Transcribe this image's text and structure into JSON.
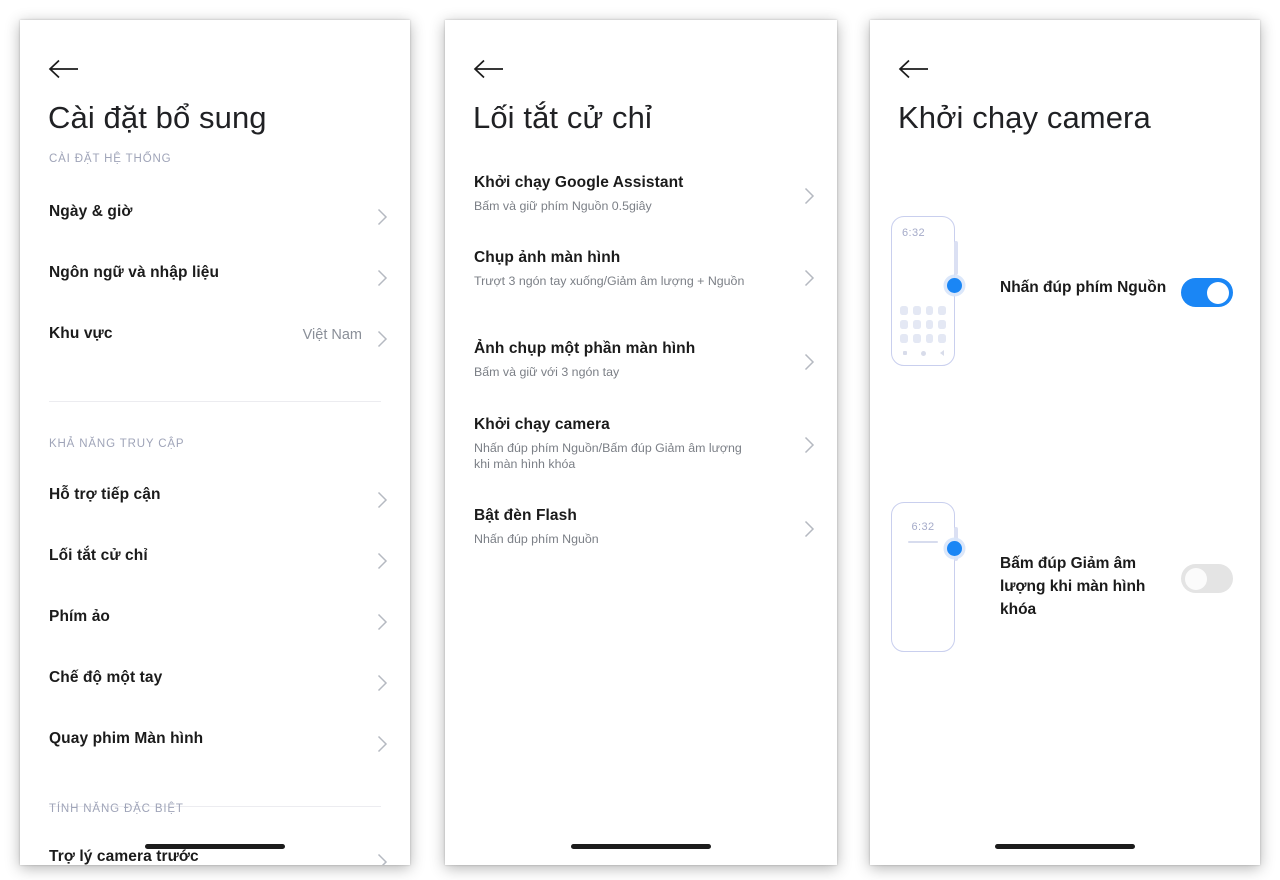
{
  "panels": [
    {
      "id": "additional-settings",
      "back_icon": "back-arrow-icon",
      "title": "Cài đặt bổ sung",
      "sections": [
        {
          "header": "CÀI ĐẶT HỆ THỐNG",
          "items": [
            {
              "label": "Ngày & giờ",
              "value": "",
              "chevron": "chevron-right-icon"
            },
            {
              "label": "Ngôn ngữ và nhập liệu",
              "value": "",
              "chevron": "chevron-right-icon"
            },
            {
              "label": "Khu vực",
              "value": "Việt Nam",
              "chevron": "chevron-right-icon"
            }
          ]
        },
        {
          "header": "KHẢ NĂNG TRUY CẬP",
          "items": [
            {
              "label": "Hỗ trợ tiếp cận",
              "value": "",
              "chevron": "chevron-right-icon"
            },
            {
              "label": "Lối tắt cử chỉ",
              "value": "",
              "chevron": "chevron-right-icon"
            },
            {
              "label": "Phím ảo",
              "value": "",
              "chevron": "chevron-right-icon"
            },
            {
              "label": "Chế độ một tay",
              "value": "",
              "chevron": "chevron-right-icon"
            },
            {
              "label": "Quay phim Màn hình",
              "value": "",
              "chevron": "chevron-right-icon"
            }
          ]
        },
        {
          "header": "TÍNH NĂNG ĐẶC BIỆT",
          "items": [
            {
              "label": "Trợ lý camera trước",
              "value": "",
              "chevron": "chevron-right-icon"
            }
          ]
        }
      ]
    },
    {
      "id": "gesture-shortcuts",
      "back_icon": "back-arrow-icon",
      "title": "Lối tắt cử chỉ",
      "items": [
        {
          "label": "Khởi chạy Google Assistant",
          "sub": "Bấm và giữ phím Nguồn 0.5giây",
          "chevron": "chevron-right-icon"
        },
        {
          "label": "Chụp ảnh màn hình",
          "sub": "Trượt 3 ngón tay xuống/Giảm âm lượng + Nguồn",
          "chevron": "chevron-right-icon"
        },
        {
          "label": "Ảnh chụp một phần màn hình",
          "sub": "Bấm và giữ với 3 ngón tay",
          "chevron": "chevron-right-icon"
        },
        {
          "label": "Khởi chạy camera",
          "sub": "Nhấn đúp phím Nguồn/Bấm đúp Giảm âm lượng khi màn hình khóa",
          "chevron": "chevron-right-icon"
        },
        {
          "label": "Bật đèn Flash",
          "sub": "Nhấn đúp phím Nguồn",
          "chevron": "chevron-right-icon"
        }
      ]
    },
    {
      "id": "launch-camera",
      "back_icon": "back-arrow-icon",
      "title": "Khởi chạy camera",
      "toggles": [
        {
          "label": "Nhấn đúp phím Nguồn",
          "state": "on",
          "illustration": "home-screen-phone-icon",
          "clock": "6:32"
        },
        {
          "label": "Bấm đúp Giảm âm lượng khi màn hình khóa",
          "state": "off",
          "illustration": "lock-screen-phone-icon",
          "clock": "6:32"
        }
      ]
    }
  ],
  "colors": {
    "accent_blue": "#1a86f5",
    "toggle_off": "#e4e4e4",
    "section_header": "#9fa4b8",
    "primary_text": "#1b1b1b",
    "secondary_text": "#7b7f86",
    "divider": "#ececf0",
    "phone_outline": "#c9cfee"
  }
}
